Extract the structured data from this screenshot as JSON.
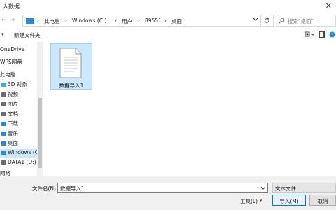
{
  "window": {
    "title": "入数据",
    "close_glyph": "✕"
  },
  "nav": {
    "back": "←",
    "forward": "→"
  },
  "address": {
    "segments": [
      "此电脑",
      "Windows (C:)",
      "用户",
      "89551",
      "桌面"
    ],
    "separator": "›"
  },
  "search": {
    "placeholder": "搜索\"桌面\""
  },
  "toolbar": {
    "organize": "▾",
    "new_folder": "新建文件夹"
  },
  "sidebar": {
    "items": [
      {
        "label": "OneDrive",
        "icon": "cloud-icon",
        "color": "#2b88d8"
      },
      {
        "label": "WPS网盘",
        "icon": "cloud-icon",
        "color": "#2b88d8"
      },
      {
        "label": "此电脑",
        "icon": "computer-icon",
        "color": "#2b88d8"
      },
      {
        "label": "3D 对象",
        "icon": "cube-icon",
        "color": "#3ab0e2"
      },
      {
        "label": "视频",
        "icon": "video-icon",
        "color": "#6d6d6d"
      },
      {
        "label": "图片",
        "icon": "picture-icon",
        "color": "#6d6d6d"
      },
      {
        "label": "文档",
        "icon": "document-icon",
        "color": "#6d6d6d"
      },
      {
        "label": "下载",
        "icon": "download-icon",
        "color": "#2b88d8"
      },
      {
        "label": "音乐",
        "icon": "music-icon",
        "color": "#2b88d8"
      },
      {
        "label": "桌面",
        "icon": "desktop-icon",
        "color": "#2b88d8"
      },
      {
        "label": "Windows (C:)",
        "icon": "drive-icon",
        "color": "#2b88d8",
        "selected": true
      },
      {
        "label": "DATA1 (D:)",
        "icon": "drive-icon",
        "color": "#6d6d6d"
      },
      {
        "label": "网络",
        "icon": "network-icon",
        "color": "#2b88d8"
      }
    ]
  },
  "files": [
    {
      "name": "数据导入1",
      "selected": true
    }
  ],
  "bottom": {
    "filename_label": "文件名(N):",
    "filename_value": "数据导入1",
    "filetype_value": "文本文件",
    "tools_label": "工具(L)",
    "import_label": "导入(M)",
    "cancel_label": "取消"
  },
  "colors": {
    "selection": "#cce8ff",
    "accent": "#0078d7"
  }
}
